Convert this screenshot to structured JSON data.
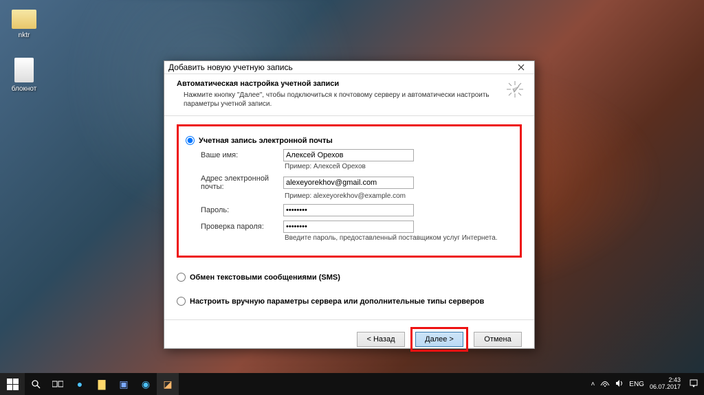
{
  "desktop": {
    "icons": [
      "nktr",
      "блокнот"
    ]
  },
  "dialog": {
    "title": "Добавить новую учетную запись",
    "subtitle": "Автоматическая настройка учетной записи",
    "description": "Нажмите кнопку \"Далее\", чтобы подключиться к почтовому серверу и автоматически настроить параметры учетной записи.",
    "option_email": "Учетная запись электронной почты",
    "option_sms": "Обмен текстовыми сообщениями (SMS)",
    "option_manual": "Настроить вручную параметры сервера или дополнительные типы серверов",
    "fields": {
      "name_label": "Ваше имя:",
      "name_value": "Алексей Орехов",
      "name_hint": "Пример: Алексей Орехов",
      "email_label": "Адрес электронной почты:",
      "email_value": "alexeyorekhov@gmail.com",
      "email_hint": "Пример: alexeyorekhov@example.com",
      "password_label": "Пароль:",
      "password_value": "********",
      "password2_label": "Проверка пароля:",
      "password2_value": "********",
      "password_hint": "Введите пароль, предоставленный поставщиком услуг Интернета."
    },
    "buttons": {
      "back": "< Назад",
      "next": "Далее >",
      "cancel": "Отмена"
    }
  },
  "taskbar": {
    "lang": "ENG",
    "time": "2:43",
    "date": "06.07.2017"
  }
}
